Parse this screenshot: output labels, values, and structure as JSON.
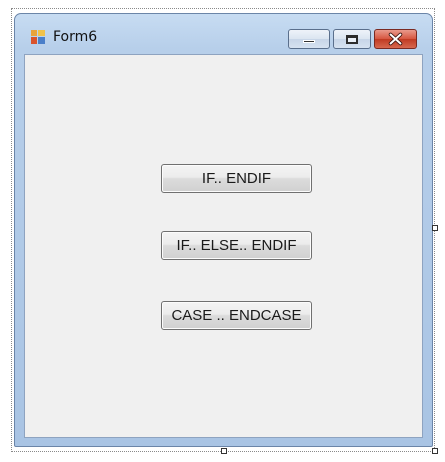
{
  "window": {
    "title": "Form6",
    "icon": "form-app-icon"
  },
  "caption_buttons": {
    "minimize": "minimize-icon",
    "maximize": "maximize-icon",
    "close": "close-icon",
    "close_color": "#c8412a"
  },
  "buttons": [
    {
      "label": "IF.. ENDIF"
    },
    {
      "label": "IF.. ELSE.. ENDIF"
    },
    {
      "label": "CASE .. ENDCASE"
    }
  ]
}
